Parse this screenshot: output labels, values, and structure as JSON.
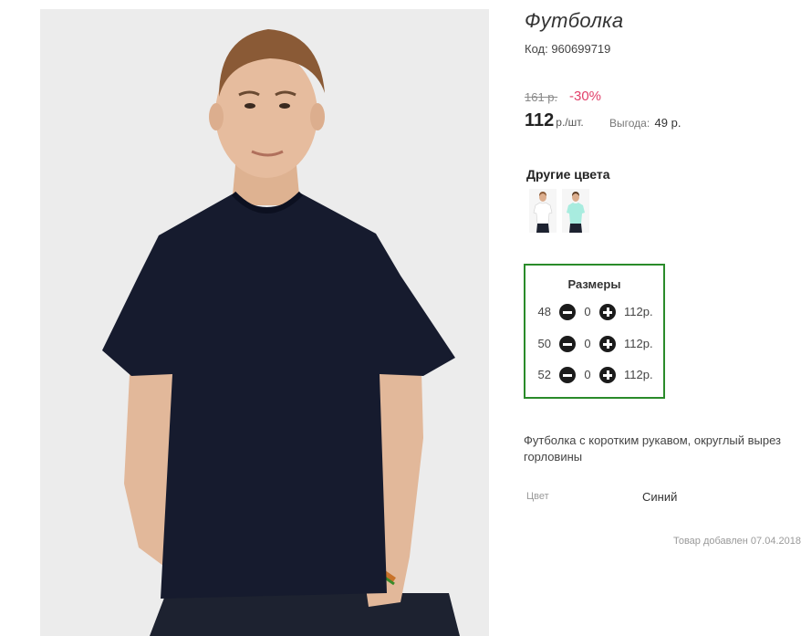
{
  "product": {
    "title": "Футболка",
    "code": "Код: 960699719",
    "image_alt": "Мужчина в тёмно-синей футболке"
  },
  "pricing": {
    "old_price": "161 р.",
    "discount": "-30%",
    "price": "112",
    "unit": "р./шт.",
    "benefit_label": "Выгода:",
    "benefit_value": "49 р."
  },
  "other_colors": {
    "title": "Другие цвета",
    "items": [
      {
        "icon": "white-tshirt-thumbnail",
        "color": "#ffffff"
      },
      {
        "icon": "mint-tshirt-thumbnail",
        "color": "#a8ecdf"
      }
    ]
  },
  "sizes": {
    "title": "Размеры",
    "rows": [
      {
        "size": "48",
        "qty": "0",
        "price": "112р."
      },
      {
        "size": "50",
        "qty": "0",
        "price": "112р."
      },
      {
        "size": "52",
        "qty": "0",
        "price": "112р."
      }
    ]
  },
  "description": "Футболка с коротким рукавом, округлый вырез горловины",
  "attributes": [
    {
      "label": "Цвет",
      "value": "Синий"
    }
  ],
  "added": "Товар добавлен 07.04.2018",
  "colors": {
    "accent_green": "#2a8b2a",
    "discount_pink": "#e2406a",
    "shirt_navy": "#161b2e"
  }
}
